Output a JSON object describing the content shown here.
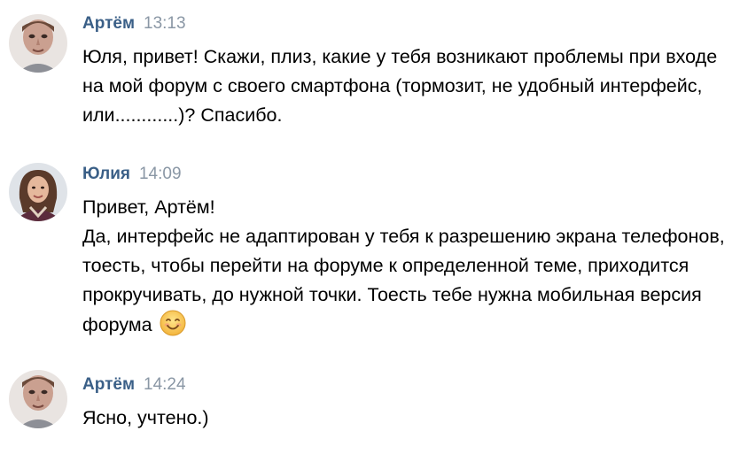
{
  "messages": [
    {
      "author": "Артём",
      "time": "13:13",
      "text": "Юля, привет! Скажи, плиз, какие у тебя возникают проблемы при входе на мой форум с своего смартфона (тормозит, не удобный интерфейс, или............)? Спасибо."
    },
    {
      "author": "Юлия",
      "time": "14:09",
      "text": "Привет, Артём!\nДа, интерфейс не адаптирован у тебя к разрешению экрана телефонов, тоесть, чтобы перейти на форуме к определенной теме, приходится прокручивать, до нужной точки. Тоесть тебе нужна мобильная версия форума",
      "emoji": "smiling-face-emoji"
    },
    {
      "author": "Артём",
      "time": "14:24",
      "text": "Ясно, учтено.)"
    }
  ],
  "colors": {
    "author": "#3a5f87",
    "time": "#8a97a5",
    "text": "#000000",
    "background": "#ffffff"
  }
}
